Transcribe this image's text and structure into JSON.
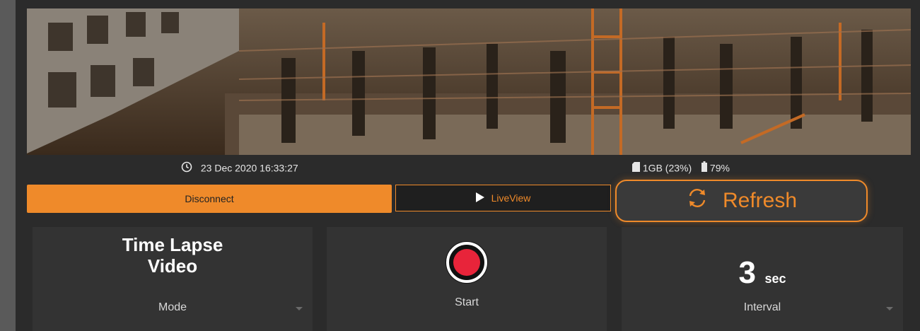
{
  "preview": {
    "image": "construction-site-photo"
  },
  "status": {
    "timestamp": "23 Dec 2020 16:33:27",
    "storage": "1GB (23%)",
    "battery": "79%"
  },
  "buttons": {
    "disconnect": "Disconnect",
    "liveview": "LiveView",
    "refresh": "Refresh"
  },
  "cards": {
    "mode": {
      "value": "Time Lapse Video",
      "line1": "Time Lapse",
      "line2": "Video",
      "caption": "Mode"
    },
    "start": {
      "caption": "Start"
    },
    "interval": {
      "value": "3",
      "unit": "sec",
      "caption": "Interval"
    }
  },
  "icons": {
    "clock": "clock-icon",
    "sd_card": "sd-card-icon",
    "battery": "battery-icon",
    "play": "play-icon",
    "refresh": "refresh-icon",
    "record": "record-icon"
  },
  "colors": {
    "accent": "#ef8a2a",
    "record": "#e8243a",
    "panel": "#333333",
    "background": "#2b2b2b"
  }
}
